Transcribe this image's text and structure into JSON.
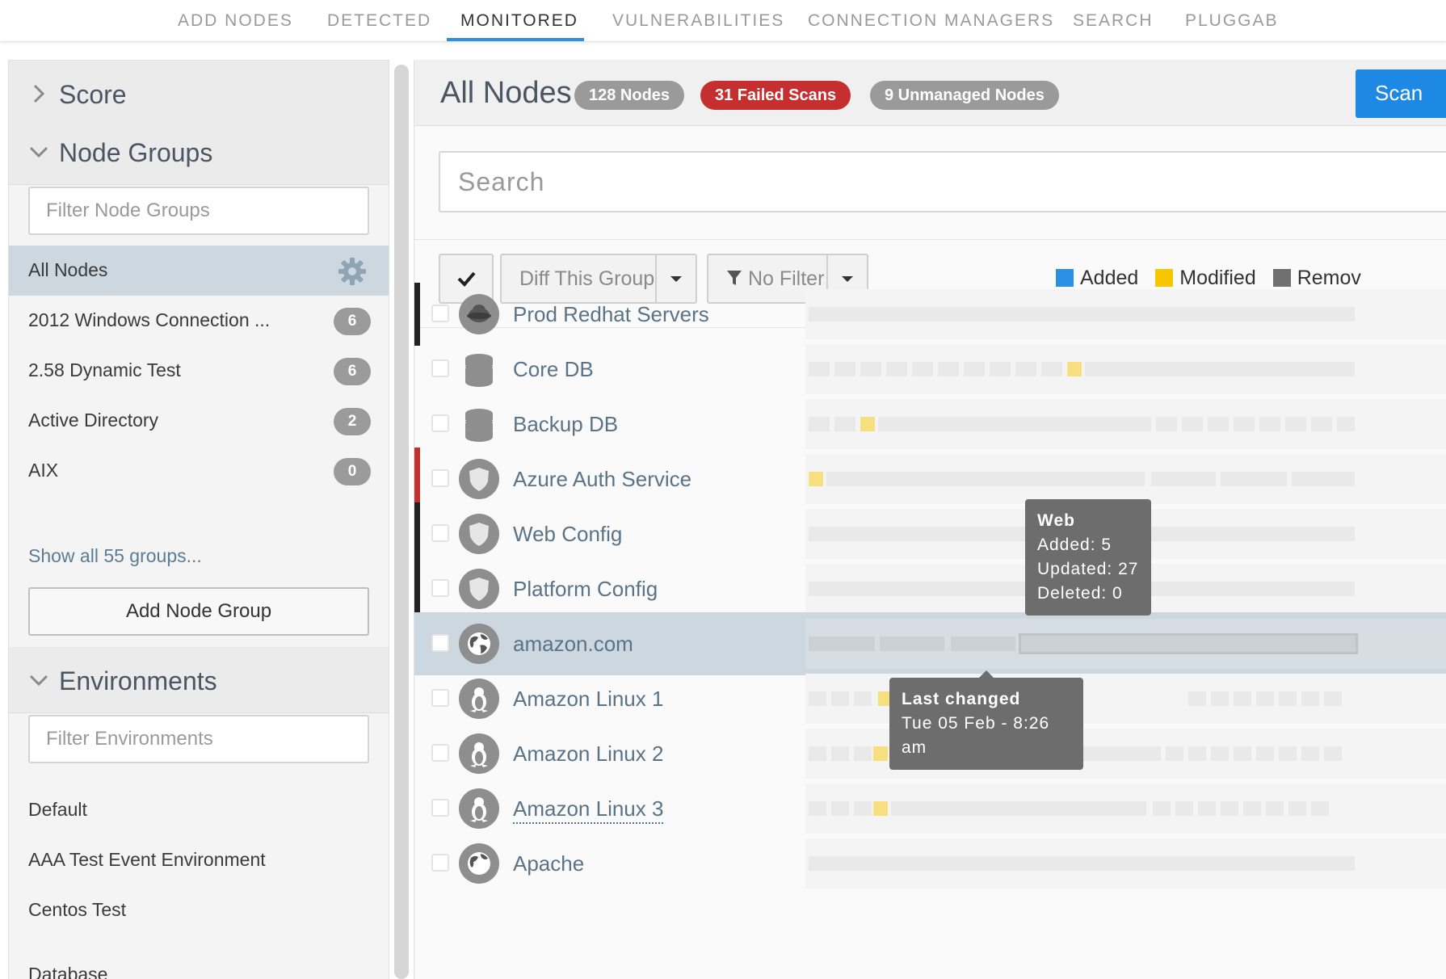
{
  "topnav": {
    "tabs": [
      {
        "label": "ADD NODES"
      },
      {
        "label": "DETECTED"
      },
      {
        "label": "MONITORED",
        "active": true
      },
      {
        "label": "VULNERABILITIES"
      },
      {
        "label": "CONNECTION MANAGERS"
      },
      {
        "label": "SEARCH"
      },
      {
        "label": "PLUGGAB"
      }
    ]
  },
  "sidebar": {
    "score_title": "Score",
    "node_groups_title": "Node Groups",
    "filter_node_groups_placeholder": "Filter Node Groups",
    "groups": [
      {
        "label": "All Nodes",
        "active": true
      },
      {
        "label": "2012 Windows Connection ...",
        "count": "6"
      },
      {
        "label": "2.58 Dynamic Test",
        "count": "6"
      },
      {
        "label": "Active Directory",
        "count": "2"
      },
      {
        "label": "AIX",
        "count": "0"
      }
    ],
    "show_all_link": "Show all 55 groups...",
    "add_group_button": "Add Node Group",
    "environments_title": "Environments",
    "filter_environments_placeholder": "Filter Environments",
    "environments": [
      "Default",
      "AAA Test Event Environment",
      "Centos Test",
      "Database"
    ]
  },
  "main": {
    "title": "All Nodes",
    "pills": {
      "nodes": "128 Nodes",
      "failed": "31 Failed Scans",
      "unmanaged": "9 Unmanaged Nodes"
    },
    "scan_button": "Scan",
    "search_placeholder": "Search",
    "toolbar": {
      "diff_button": "Diff This Group",
      "filter_button": "No Filter",
      "legend": {
        "added": "Added",
        "modified": "Modified",
        "removed": "Remov"
      }
    },
    "rows": [
      {
        "name": "Prod Redhat Servers",
        "icon": "redhat-icon"
      },
      {
        "name": "Core DB",
        "icon": "database-icon"
      },
      {
        "name": "Backup DB",
        "icon": "database-icon"
      },
      {
        "name": "Azure Auth Service",
        "icon": "shield-icon"
      },
      {
        "name": "Web Config",
        "icon": "shield-icon"
      },
      {
        "name": "Platform Config",
        "icon": "shield-icon"
      },
      {
        "name": "amazon.com",
        "icon": "globe-icon",
        "selected": true
      },
      {
        "name": "Amazon Linux 1",
        "icon": "linux-icon"
      },
      {
        "name": "Amazon Linux 2",
        "icon": "linux-icon"
      },
      {
        "name": "Amazon Linux 3",
        "icon": "linux-icon"
      },
      {
        "name": "Apache",
        "icon": "globe-icon"
      }
    ],
    "tooltip_web": {
      "title": "Web",
      "added": "Added: 5",
      "updated": "Updated: 27",
      "deleted": "Deleted: 0"
    },
    "tooltip_changed": {
      "title": "Last changed",
      "date": "Tue 05 Feb - 8:26 am"
    }
  },
  "colors": {
    "accent": "#1e88e5",
    "failed": "#c62f2f",
    "added": "#2b8fe5",
    "modified": "#f7c600",
    "removed": "#707070",
    "selected_row": "#ccd7e0"
  }
}
